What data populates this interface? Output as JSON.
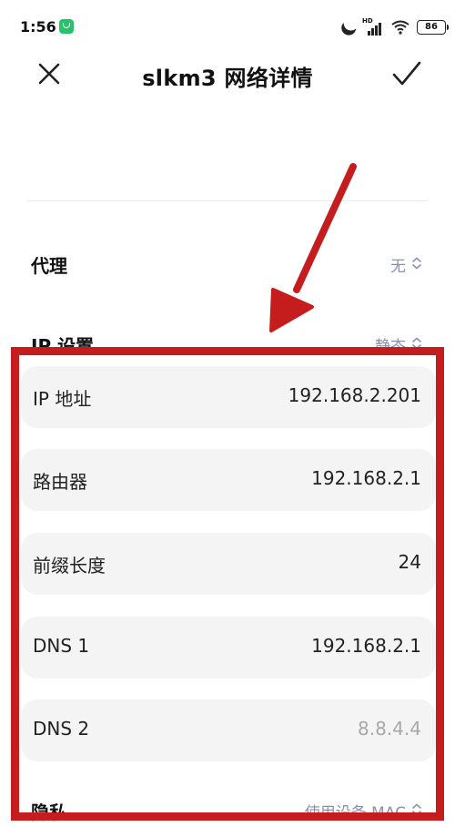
{
  "status_bar": {
    "time": "1:56",
    "network_label": "HD",
    "battery_level": "86",
    "icons": [
      "app-notification-icon",
      "moon-icon",
      "signal-icon",
      "wifi-icon",
      "battery-icon"
    ]
  },
  "header": {
    "title": "slkm3 网络详情",
    "close_icon": "close-icon",
    "confirm_icon": "check-icon"
  },
  "settings": [
    {
      "label": "代理",
      "value": "无"
    },
    {
      "label": "IP 设置",
      "value": "静态"
    }
  ],
  "ip_fields": [
    {
      "label": "IP 地址",
      "value": "192.168.2.201"
    },
    {
      "label": "路由器",
      "value": "192.168.2.1"
    },
    {
      "label": "前缀长度",
      "value": "24"
    },
    {
      "label": "DNS 1",
      "value": "192.168.2.1"
    },
    {
      "label": "DNS 2",
      "value": "8.8.4.4"
    }
  ],
  "privacy": {
    "label": "隐私",
    "value": "使用设备 MAC"
  },
  "colors": {
    "annotation_red": "#c51d1d",
    "value_gray_blue": "#8a90b0",
    "card_bg": "#f4f4f4"
  }
}
